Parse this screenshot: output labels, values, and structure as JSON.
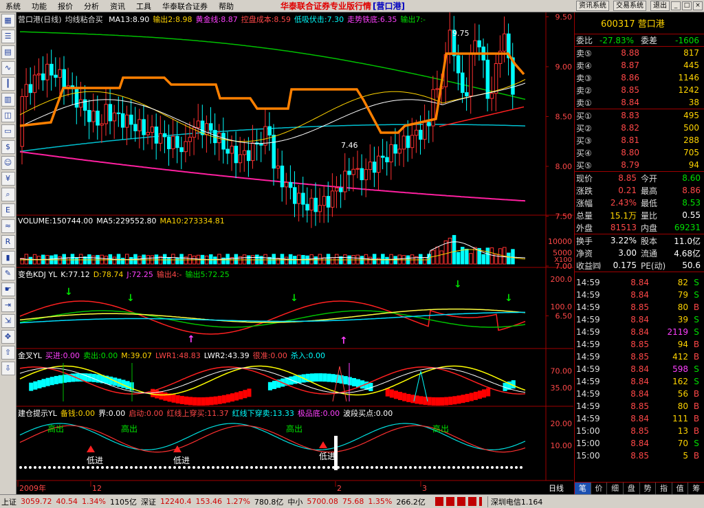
{
  "menubar": {
    "items": [
      "系统",
      "功能",
      "报价",
      "分析",
      "资讯",
      "工具",
      "华泰联合证券",
      "帮助"
    ],
    "title": "华泰联合证券专业版行情",
    "title_code": "[营口港]",
    "right_buttons": [
      "资讯系统",
      "交易系统",
      "退出"
    ]
  },
  "toolbar_icons": [
    "chart-icon",
    "list-icon",
    "grid-icon",
    "line-icon",
    "candle-icon",
    "table-icon",
    "window-icon",
    "doc-icon",
    "dollar-icon",
    "people-icon",
    "yen-icon",
    "search-icon",
    "etf-icon",
    "wave-icon",
    "rsi-icon",
    "bars-icon",
    "wrench-icon",
    "hand-icon",
    "exit-icon",
    "export-icon",
    "move-icon",
    "up-arrow-icon",
    "down-arrow-icon"
  ],
  "panels": {
    "main": {
      "title": "营口港(日线)",
      "indicator": "均线粘合买",
      "items": [
        {
          "text": "MA13:8.90",
          "color": "#ffffff"
        },
        {
          "text": "输出2:8.98",
          "color": "#ffd400"
        },
        {
          "text": "黄金线:8.87",
          "color": "#ff40ff"
        },
        {
          "text": "控盘成本:8.59",
          "color": "#ff4848"
        },
        {
          "text": "低吸伏击:7.30",
          "color": "#00ffff"
        },
        {
          "text": "走势铁底:6.35",
          "color": "#ff40ff"
        },
        {
          "text": "输出7:-",
          "color": "#00e000"
        }
      ],
      "price_ticks": [
        "9.50",
        "9.00",
        "8.50",
        "8.00",
        "7.50",
        "7.00",
        "6.50"
      ],
      "high_label": "9.75",
      "low_label": "7.46"
    },
    "volume": {
      "items": [
        {
          "text": "VOLUME:150744.00",
          "color": "#ffffff"
        },
        {
          "text": "MA5:229552.80",
          "color": "#ffffff"
        },
        {
          "text": "MA10:273334.81",
          "color": "#ffd400"
        }
      ],
      "ticks": [
        "10000",
        "5000"
      ],
      "unit": "X100"
    },
    "kdj": {
      "items": [
        {
          "text": "变色KDJ YL",
          "color": "#ffffff"
        },
        {
          "text": "K:77.12",
          "color": "#ffffff"
        },
        {
          "text": "D:78.74",
          "color": "#ffd400"
        },
        {
          "text": "J:72.25",
          "color": "#ff40ff"
        },
        {
          "text": "输出4:-",
          "color": "#ff4848"
        },
        {
          "text": "输出5:72.25",
          "color": "#00e000"
        }
      ],
      "ticks": [
        "200.0",
        "100.0"
      ]
    },
    "jincha": {
      "items": [
        {
          "text": "金叉YL",
          "color": "#ffffff"
        },
        {
          "text": "买进:0.00",
          "color": "#ff40ff"
        },
        {
          "text": "卖出:0.00",
          "color": "#00e000"
        },
        {
          "text": "M:39.07",
          "color": "#ffd400"
        },
        {
          "text": "LWR1:48.83",
          "color": "#ff4848"
        },
        {
          "text": "LWR2:43.39",
          "color": "#ffffff"
        },
        {
          "text": "很准:0.00",
          "color": "#ff4848"
        },
        {
          "text": "杀入:0.00",
          "color": "#00ffff"
        }
      ],
      "ticks": [
        "70.00",
        "35.00"
      ]
    },
    "jiancang": {
      "items": [
        {
          "text": "建仓提示YL",
          "color": "#ffffff"
        },
        {
          "text": "备钱:0.00",
          "color": "#ffd400"
        },
        {
          "text": "界:0.00",
          "color": "#ffffff"
        },
        {
          "text": "启动:0.00",
          "color": "#ff4848"
        },
        {
          "text": "红线上穿买:11.37",
          "color": "#ff4848"
        },
        {
          "text": "红线下穿卖:13.33",
          "color": "#00ffff"
        },
        {
          "text": "极品底:0.00",
          "color": "#ff40ff"
        },
        {
          "text": "波段买点:0.00",
          "color": "#ffffff"
        }
      ],
      "ticks": [
        "20.00",
        "10.00"
      ],
      "labels": {
        "high_out": "高出",
        "low_in": "低进"
      }
    },
    "date_axis": [
      "2009年",
      "12",
      "2",
      "3"
    ],
    "period_label": "日线"
  },
  "quote": {
    "code": "600317",
    "name": "营口港",
    "weibi_label": "委比",
    "weibi": "-27.83%",
    "weicha_label": "委差",
    "weicha": "-1606",
    "asks": [
      {
        "label": "卖⑤",
        "price": "8.88",
        "vol": "817"
      },
      {
        "label": "卖④",
        "price": "8.87",
        "vol": "445"
      },
      {
        "label": "卖③",
        "price": "8.86",
        "vol": "1146"
      },
      {
        "label": "卖②",
        "price": "8.85",
        "vol": "1242"
      },
      {
        "label": "卖①",
        "price": "8.84",
        "vol": "38"
      }
    ],
    "bids": [
      {
        "label": "买①",
        "price": "8.83",
        "vol": "495"
      },
      {
        "label": "买②",
        "price": "8.82",
        "vol": "500"
      },
      {
        "label": "买③",
        "price": "8.81",
        "vol": "288"
      },
      {
        "label": "买④",
        "price": "8.80",
        "vol": "705"
      },
      {
        "label": "买⑤",
        "price": "8.79",
        "vol": "94"
      }
    ],
    "stats": [
      {
        "l1": "现价",
        "v1": "8.85",
        "c1": "red",
        "l2": "今开",
        "v2": "8.60",
        "c2": "green"
      },
      {
        "l1": "涨跌",
        "v1": "0.21",
        "c1": "red",
        "l2": "最高",
        "v2": "8.86",
        "c2": "red"
      },
      {
        "l1": "涨幅",
        "v1": "2.43%",
        "c1": "red",
        "l2": "最低",
        "v2": "8.53",
        "c2": "green"
      },
      {
        "l1": "总量",
        "v1": "15.1万",
        "c1": "yellow",
        "l2": "量比",
        "v2": "0.55",
        "c2": "white"
      },
      {
        "l1": "外盘",
        "v1": "81513",
        "c1": "red",
        "l2": "内盘",
        "v2": "69231",
        "c2": "green"
      }
    ],
    "stats2": [
      {
        "l1": "换手",
        "v1": "3.22%",
        "c1": "white",
        "l2": "股本",
        "v2": "11.0亿",
        "c2": "white"
      },
      {
        "l1": "净资",
        "v1": "3.00",
        "c1": "white",
        "l2": "流通",
        "v2": "4.68亿",
        "c2": "white"
      },
      {
        "l1": "收益㈣",
        "v1": "0.175",
        "c1": "white",
        "l2": "PE(动)",
        "v2": "50.6",
        "c2": "white"
      }
    ],
    "ticks": [
      {
        "time": "14:59",
        "price": "8.84",
        "vol": "82",
        "side": "S"
      },
      {
        "time": "14:59",
        "price": "8.84",
        "vol": "79",
        "side": "S"
      },
      {
        "time": "14:59",
        "price": "8.85",
        "vol": "80",
        "side": "B"
      },
      {
        "time": "14:59",
        "price": "8.84",
        "vol": "39",
        "side": "S"
      },
      {
        "time": "14:59",
        "price": "8.84",
        "vol": "2119",
        "side": "S"
      },
      {
        "time": "14:59",
        "price": "8.85",
        "vol": "94",
        "side": "B"
      },
      {
        "time": "14:59",
        "price": "8.85",
        "vol": "412",
        "side": "B"
      },
      {
        "time": "14:59",
        "price": "8.84",
        "vol": "598",
        "side": "S"
      },
      {
        "time": "14:59",
        "price": "8.84",
        "vol": "162",
        "side": "S"
      },
      {
        "time": "14:59",
        "price": "8.84",
        "vol": "56",
        "side": "B"
      },
      {
        "time": "14:59",
        "price": "8.85",
        "vol": "80",
        "side": "B"
      },
      {
        "time": "14:59",
        "price": "8.84",
        "vol": "111",
        "side": "B"
      },
      {
        "time": "15:00",
        "price": "8.85",
        "vol": "13",
        "side": "B"
      },
      {
        "time": "15:00",
        "price": "8.84",
        "vol": "70",
        "side": "S"
      },
      {
        "time": "15:00",
        "price": "8.85",
        "vol": "5",
        "side": "B"
      }
    ],
    "tabs": [
      "笔",
      "价",
      "细",
      "盘",
      "势",
      "指",
      "值",
      "筹"
    ]
  },
  "status": {
    "sh_label": "上证",
    "sh_index": "3059.72",
    "sh_change": "40.54",
    "sh_pct": "1.34%",
    "sh_amount": "1105亿",
    "sz_label": "深证",
    "sz_index": "12240.4",
    "sz_change": "153.46",
    "sz_pct": "1.27%",
    "sz_amount": "780.8亿",
    "zx_label": "中小",
    "zx_index": "5700.08",
    "zx_change": "75.68",
    "zx_pct": "1.35%",
    "zx_amount": "266.2亿",
    "news": "深圳电信1.164"
  }
}
